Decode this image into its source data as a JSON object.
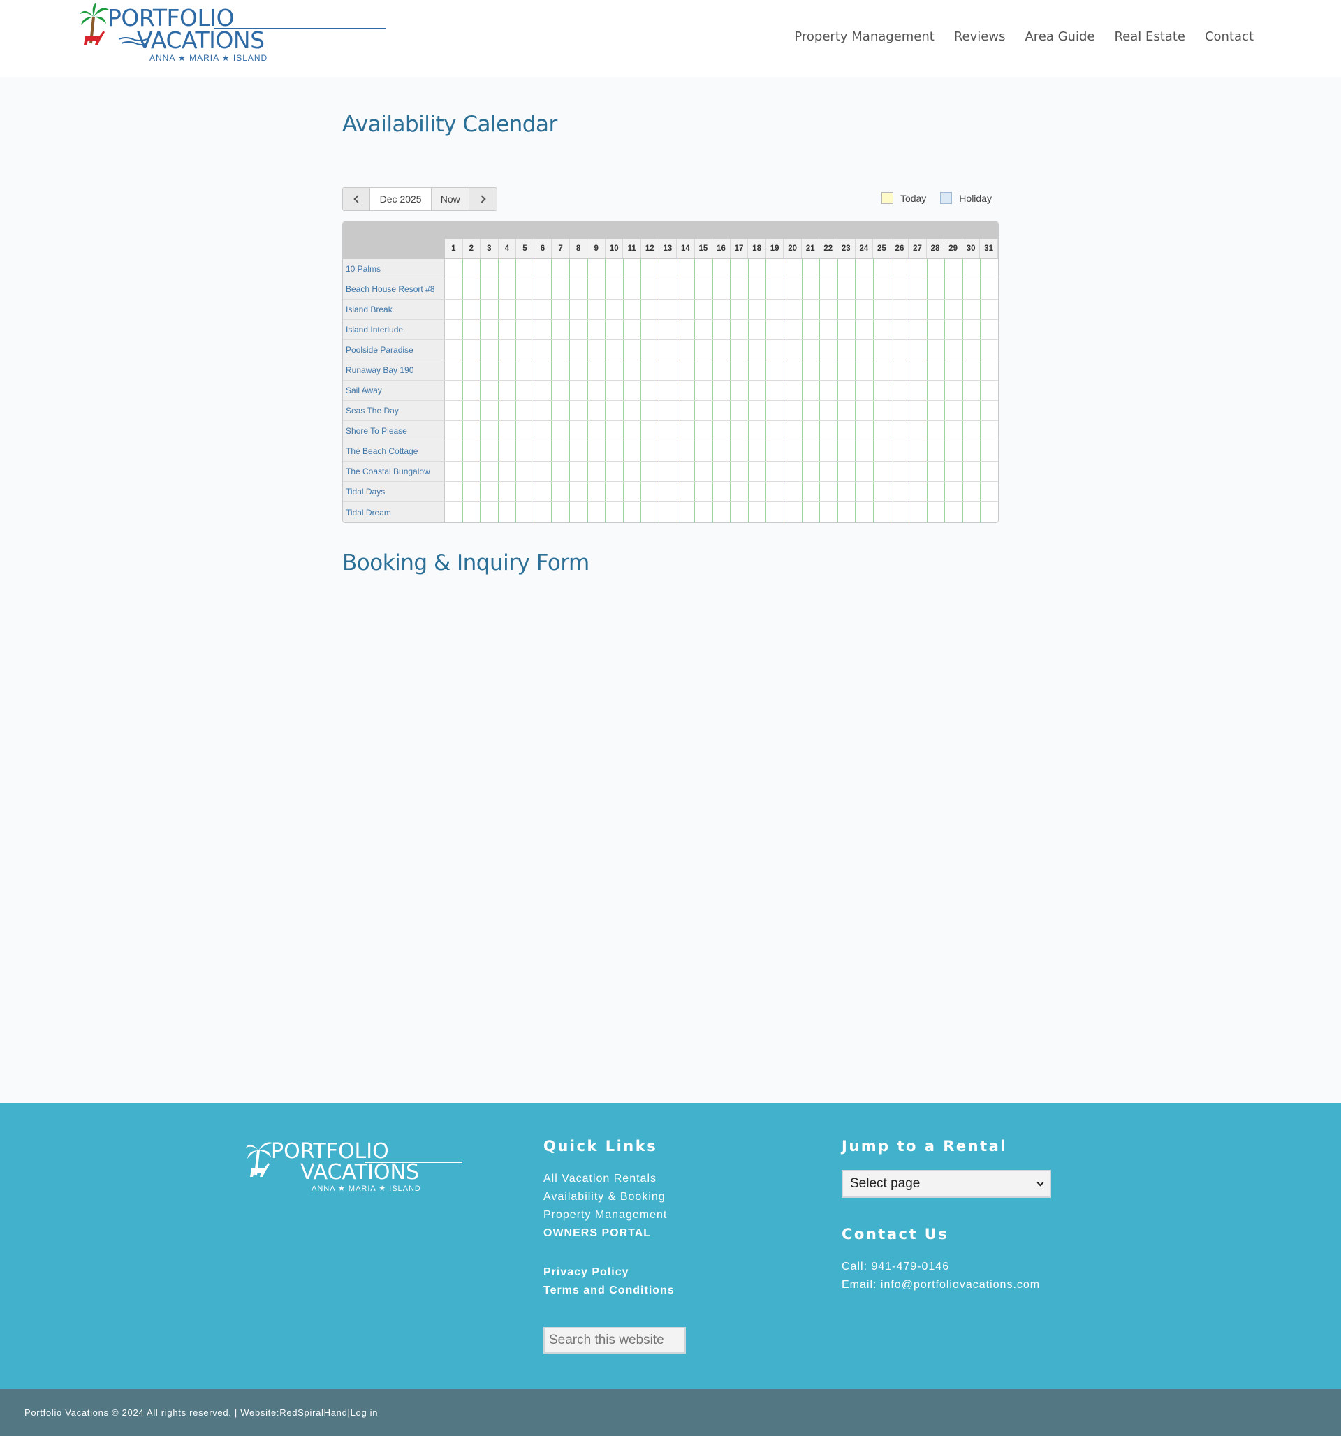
{
  "header": {
    "logo": {
      "word1": "PORTFOLIO",
      "word2": "VACATIONS",
      "tagline": "ANNA ★ MARIA ★ ISLAND"
    },
    "nav": [
      "Property Management",
      "Reviews",
      "Area Guide",
      "Real Estate",
      "Contact"
    ]
  },
  "page": {
    "title": "Availability Calendar",
    "section_title": "Booking & Inquiry Form"
  },
  "calendar": {
    "month_label": "Dec 2025",
    "now_label": "Now",
    "legend": {
      "today": "Today",
      "holiday": "Holiday"
    },
    "days": [
      "1",
      "2",
      "3",
      "4",
      "5",
      "6",
      "7",
      "8",
      "9",
      "10",
      "11",
      "12",
      "13",
      "14",
      "15",
      "16",
      "17",
      "18",
      "19",
      "20",
      "21",
      "22",
      "23",
      "24",
      "25",
      "26",
      "27",
      "28",
      "29",
      "30",
      "31"
    ],
    "properties": [
      "10 Palms",
      "Beach House Resort #8",
      "Island Break",
      "Island Interlude",
      "Poolside Paradise",
      "Runaway Bay 190",
      "Sail Away",
      "Seas The Day",
      "Shore To Please",
      "The Beach Cottage",
      "The Coastal Bungalow",
      "Tidal Days",
      "Tidal Dream"
    ]
  },
  "footer": {
    "logo": {
      "word1": "PORTFOLIO",
      "word2": "VACATIONS",
      "tagline": "ANNA ★ MARIA ★ ISLAND"
    },
    "quick_links_title": "Quick Links",
    "quick_links": [
      "All Vacation Rentals",
      "Availability & Booking",
      "Property Management"
    ],
    "owners_portal": "OWNERS PORTAL",
    "privacy": "Privacy Policy",
    "terms": "Terms and Conditions",
    "search_placeholder": "Search this website",
    "jump_title": "Jump to a Rental",
    "jump_select": "Select page",
    "contact_title": "Contact Us",
    "phone": "Call: 941-479-0146",
    "email": "Email: info@portfoliovacations.com"
  },
  "bottom_bar": {
    "copyright": "Portfolio Vacations © 2024 All rights reserved. | Website: ",
    "website_link": "RedSpiralHand",
    "separator": " | ",
    "login": "Log in"
  },
  "colors": {
    "brand_blue": "#2e6aa5",
    "heading_blue": "#2b6f97",
    "footer_bg": "#42b1cc",
    "bottom_bar_bg": "#537783",
    "palm_green": "#1e9b3c",
    "chair_red": "#d8252c"
  }
}
